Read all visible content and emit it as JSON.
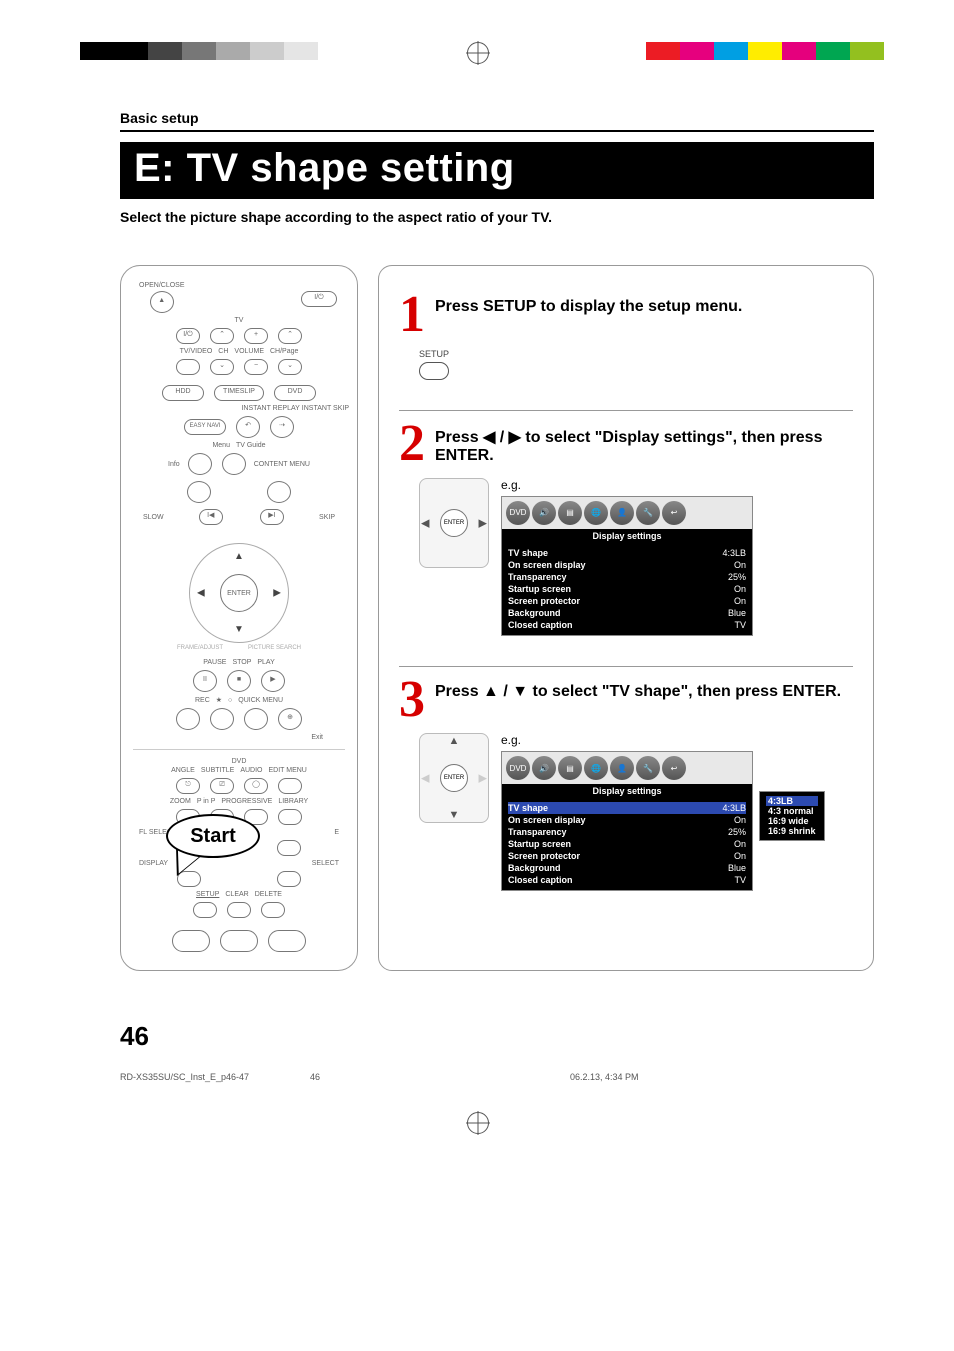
{
  "breadcrumb": "Basic setup",
  "title": "E: TV shape setting",
  "intro": "Select the picture shape according to the aspect ratio of your TV.",
  "remote": {
    "open_close": "OPEN/CLOSE",
    "tv": "TV",
    "tv_video": "TV/VIDEO",
    "ch": "CH",
    "volume": "VOLUME",
    "ch_page": "CH/Page",
    "hdd": "HDD",
    "timeslip": "TIMESLIP",
    "dvd": "DVD",
    "instant_replay": "INSTANT REPLAY",
    "instant_skip": "INSTANT SKIP",
    "easy_navi": "EASY\nNAVI",
    "menu": "Menu",
    "tv_guide": "TV Guide",
    "info": "Info",
    "content_menu": "CONTENT MENU",
    "slow": "SLOW",
    "skip": "SKIP",
    "enter": "ENTER",
    "frame_adjust": "FRAME/ADJUST",
    "picture_search": "PICTURE SEARCH",
    "pause": "PAUSE",
    "stop": "STOP",
    "play": "PLAY",
    "rec": "REC",
    "quick_menu": "QUICK MENU",
    "exit": "Exit",
    "dvd_sep": "DVD",
    "angle": "ANGLE",
    "subtitle": "SUBTITLE",
    "audio": "AUDIO",
    "edit_menu": "EDIT MENU",
    "zoom": "ZOOM",
    "pinp": "P in P",
    "progressive": "PROGRESSIVE",
    "library": "LIBRARY",
    "fl_select": "FL SELECT",
    "display": "DISPLAY",
    "select": "SELECT",
    "setup": "SETUP",
    "clear": "CLEAR",
    "delete": "DELETE",
    "start": "Start"
  },
  "steps": [
    {
      "num": "1",
      "text": "Press SETUP to display the setup menu.",
      "button_label": "SETUP"
    },
    {
      "num": "2",
      "text": "Press ◀ / ▶ to select \"Display settings\", then press ENTER.",
      "enter": "ENTER",
      "eg": "e.g.",
      "menu_title": "Display settings",
      "rows": [
        {
          "k": "TV shape",
          "v": "4:3LB"
        },
        {
          "k": "On screen display",
          "v": "On"
        },
        {
          "k": "Transparency",
          "v": "25%"
        },
        {
          "k": "Startup screen",
          "v": "On"
        },
        {
          "k": "Screen protector",
          "v": "On"
        },
        {
          "k": "Background",
          "v": "Blue"
        },
        {
          "k": "Closed caption",
          "v": "TV"
        }
      ]
    },
    {
      "num": "3",
      "text": "Press ▲ / ▼ to select \"TV shape\", then press ENTER.",
      "enter": "ENTER",
      "eg": "e.g.",
      "menu_title": "Display settings",
      "rows": [
        {
          "k": "TV shape",
          "v": "4:3LB",
          "hl": true
        },
        {
          "k": "On screen display",
          "v": "On"
        },
        {
          "k": "Transparency",
          "v": "25%"
        },
        {
          "k": "Startup screen",
          "v": "On"
        },
        {
          "k": "Screen protector",
          "v": "On"
        },
        {
          "k": "Background",
          "v": "Blue"
        },
        {
          "k": "Closed caption",
          "v": "TV"
        }
      ],
      "popup": [
        "4:3LB",
        "4:3 normal",
        "16:9 wide",
        "16:9 shrink"
      ]
    }
  ],
  "page_number": "46",
  "footer": {
    "file": "RD-XS35SU/SC_Inst_E_p46-47",
    "page": "46",
    "datetime": "06.2.13, 4:34 PM"
  }
}
